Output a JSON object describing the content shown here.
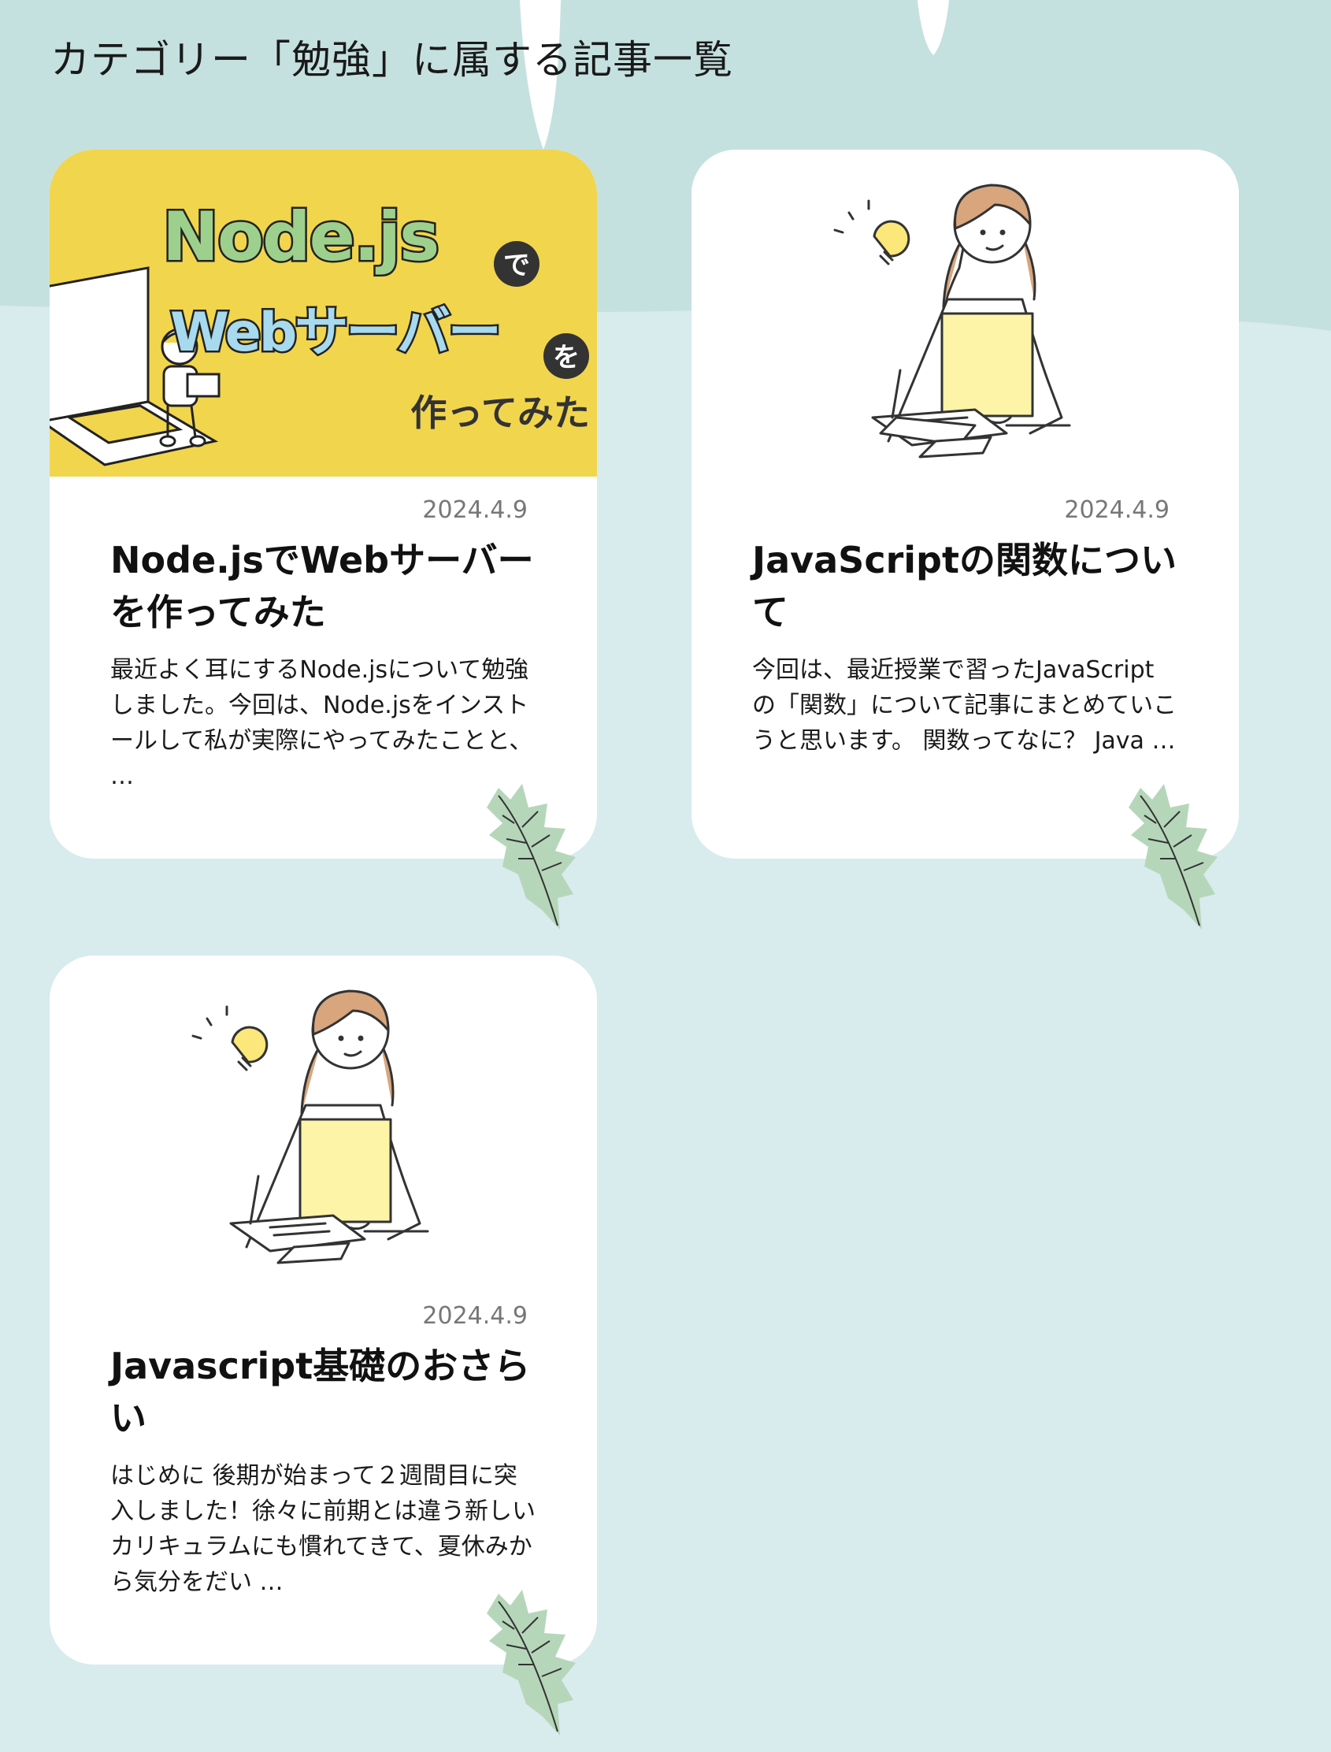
{
  "page": {
    "heading": "カテゴリー「勉強」に属する記事一覧"
  },
  "colors": {
    "background": "#d8ebed",
    "background_top": "#c5e1df",
    "card": "#ffffff",
    "thumb_yellow": "#f1d54d",
    "holly_leaf": "#b6d6ba"
  },
  "articles": [
    {
      "date": "2024.4.9",
      "title": "Node.jsでWebサーバーを作ってみた",
      "excerpt": "最近よく耳にするNode.jsについて勉強しました。今回は、Node.jsをインストールして私が実際にやってみたことと、 …",
      "thumbnail": {
        "line1": "Node.js",
        "particle1": "で",
        "line2": "Webサーバー",
        "particle2": "を",
        "line3": "作ってみた"
      }
    },
    {
      "date": "2024.4.9",
      "title": "JavaScriptの関数について",
      "excerpt": "今回は、最近授業で習ったJavaScriptの「関数」について記事にまとめていこうと思います。 関数ってなに？ Java …",
      "thumbnail": {
        "icon": "studying-girl-illustration"
      }
    },
    {
      "date": "2024.4.9",
      "title": "Javascript基礎のおさらい",
      "excerpt": "はじめに 後期が始まって２週間目に突入しました！徐々に前期とは違う新しいカリキュラムにも慣れてきて、夏休みから気分をだい …",
      "thumbnail": {
        "icon": "studying-girl-illustration"
      }
    }
  ]
}
